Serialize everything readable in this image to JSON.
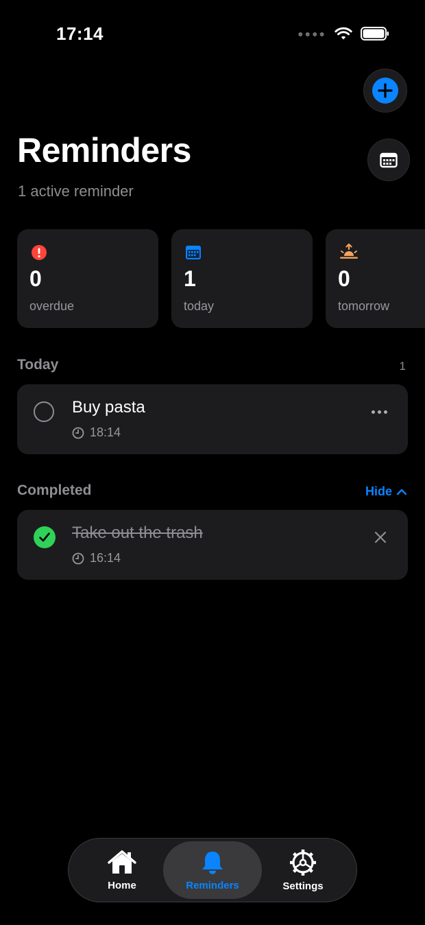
{
  "status_bar": {
    "time": "17:14"
  },
  "header": {
    "title": "Reminders",
    "subtitle": "1 active reminder",
    "add_icon": "plus-icon",
    "calendar_icon": "calendar-icon"
  },
  "stats": [
    {
      "value": "0",
      "label": "overdue",
      "icon": "exclamation-icon",
      "color": "#ff453a"
    },
    {
      "value": "1",
      "label": "today",
      "icon": "calendar-icon",
      "color": "#0a84ff"
    },
    {
      "value": "0",
      "label": "tomorrow",
      "icon": "sunrise-icon",
      "color": "#f2a35e"
    }
  ],
  "today": {
    "title": "Today",
    "count": "1",
    "items": [
      {
        "title": "Buy pasta",
        "time": "18:14",
        "completed": false
      }
    ]
  },
  "completed": {
    "title": "Completed",
    "toggle_label": "Hide",
    "items": [
      {
        "title": "Take out the trash",
        "time": "16:14",
        "completed": true
      }
    ]
  },
  "tab_bar": {
    "tabs": [
      {
        "label": "Home",
        "icon": "home-icon"
      },
      {
        "label": "Reminders",
        "icon": "bell-icon",
        "selected": true
      },
      {
        "label": "Settings",
        "icon": "gear-icon"
      }
    ]
  },
  "colors": {
    "accent": "#0a84ff",
    "success": "#30d158",
    "danger": "#ff453a",
    "card": "#1c1c1e",
    "background": "#000000"
  }
}
